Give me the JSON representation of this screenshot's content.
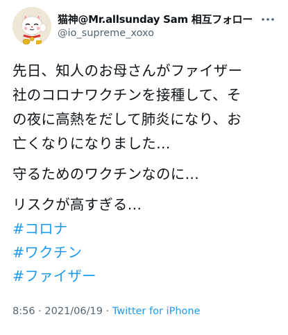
{
  "tweet": {
    "display_name": "猫神@Mr.allsunday Sam 相互フォロー",
    "handle": "@io_supreme_xoxo",
    "paragraphs": [
      "先日、知人のお母さんがファイザー\n社のコロナワクチンを接種して、そ\nの夜に高熱をだして肺炎になり、お\n亡くなりになりました…",
      "守るためのワクチンなのに…",
      "リスクが高すぎる…"
    ],
    "hashtags": [
      "#コロナ",
      "#ワクチン",
      "#ファイザー"
    ],
    "time": "8:56",
    "separator": "·",
    "date": "2021/06/19",
    "source": "Twitter for iPhone"
  },
  "icons": {
    "avatar": "lucky-cat-avatar",
    "more": "more-icon"
  },
  "colors": {
    "text": "#0f1419",
    "secondary": "#536471",
    "link": "#1d9bf0",
    "background": "#ffffff"
  }
}
